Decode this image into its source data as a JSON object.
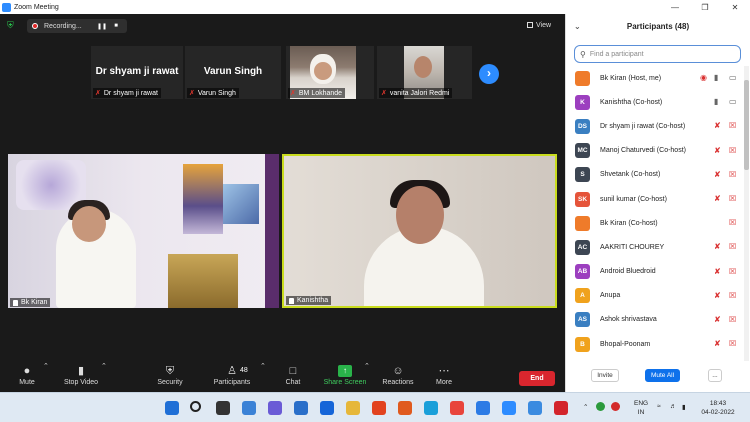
{
  "window": {
    "title": "Zoom Meeting"
  },
  "recording": {
    "label": "Recording..."
  },
  "view": {
    "label": "View"
  },
  "strip": [
    {
      "name": "Dr shyam ji rawat",
      "label": "Dr shyam ji rawat"
    },
    {
      "name": "Varun Singh",
      "label": "Varun Singh"
    },
    {
      "label": "BM Lokhande"
    },
    {
      "label": "vanita Jalori Redmi"
    }
  ],
  "tiles": [
    {
      "label": "Bk Kiran"
    },
    {
      "label": "Kanishtha"
    }
  ],
  "toolbar": {
    "mute": "Mute",
    "stop_video": "Stop Video",
    "security": "Security",
    "participants": "Participants",
    "participants_count": "48",
    "chat": "Chat",
    "share_screen": "Share Screen",
    "reactions": "Reactions",
    "more": "More",
    "end": "End"
  },
  "panel": {
    "title": "Participants (48)",
    "search_placeholder": "Find a participant",
    "participants": [
      {
        "initials": "",
        "name": "Bk Kiran (Host, me)",
        "color": "#ef7b2a",
        "mic": "on",
        "video": "on",
        "rec": true
      },
      {
        "initials": "K",
        "name": "Kanishtha (Co-host)",
        "color": "#9c3fbf",
        "mic": "on",
        "video": "on",
        "rec": false
      },
      {
        "initials": "DS",
        "name": "Dr shyam ji rawat (Co-host)",
        "color": "#3a7fc1",
        "mic": "muted",
        "video": "off",
        "rec": false
      },
      {
        "initials": "MC",
        "name": "Manoj Chaturvedi (Co-host)",
        "color": "#3d4653",
        "mic": "muted",
        "video": "off",
        "rec": false
      },
      {
        "initials": "S",
        "name": "Shvetank (Co-host)",
        "color": "#3d4653",
        "mic": "muted",
        "video": "off",
        "rec": false
      },
      {
        "initials": "SK",
        "name": "sunil kumar (Co-host)",
        "color": "#e5543a",
        "mic": "muted",
        "video": "off",
        "rec": false
      },
      {
        "initials": "",
        "name": "Bk Kiran (Co-host)",
        "color": "#ef7b2a",
        "mic": "none",
        "video": "off",
        "rec": false
      },
      {
        "initials": "AC",
        "name": "AAKRITI  CHOUREY",
        "color": "#3d4653",
        "mic": "muted",
        "video": "off",
        "rec": false
      },
      {
        "initials": "AB",
        "name": "Android Bluedroid",
        "color": "#9c3fbf",
        "mic": "muted",
        "video": "off",
        "rec": false
      },
      {
        "initials": "A",
        "name": "Anupa",
        "color": "#f0a21d",
        "mic": "muted",
        "video": "off",
        "rec": false
      },
      {
        "initials": "AS",
        "name": "Ashok shrivastava",
        "color": "#3a7fc1",
        "mic": "muted",
        "video": "off",
        "rec": false
      },
      {
        "initials": "B",
        "name": "Bhopal-Poonam",
        "color": "#f0a21d",
        "mic": "muted",
        "video": "off",
        "rec": false
      }
    ],
    "invite": "Invite",
    "mute_all": "Mute All",
    "more": "..."
  },
  "taskbar": {
    "lang1": "ENG",
    "lang2": "IN",
    "time": "18:43",
    "date": "04-02-2022"
  }
}
